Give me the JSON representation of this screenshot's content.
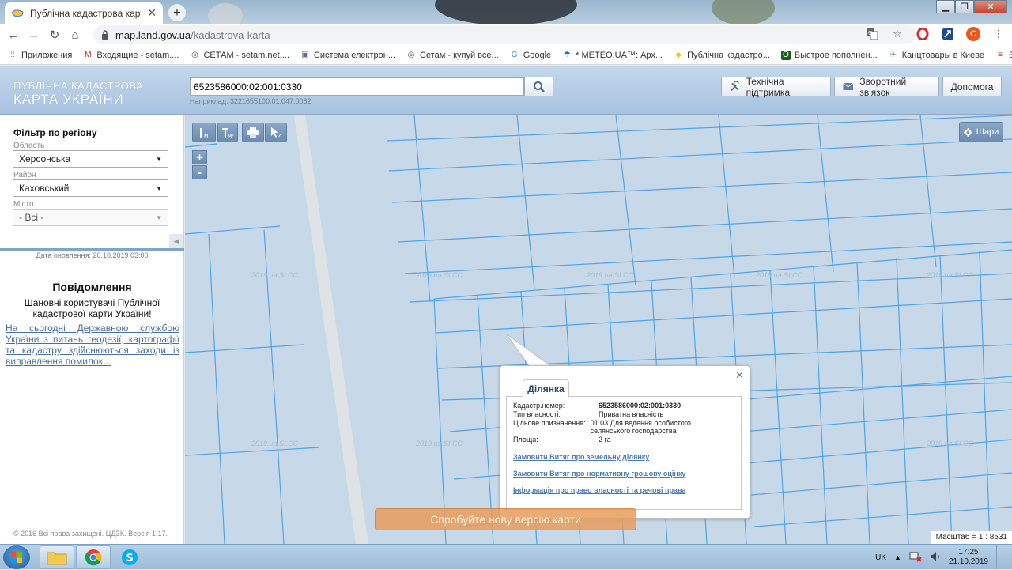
{
  "browser": {
    "tab_title": "Публічна кадастрова карта Укр",
    "url_host": "map.land.gov.ua",
    "url_path": "/kadastrova-karta",
    "profile_initial": "С",
    "bookmarks": [
      {
        "label": "Приложения",
        "icon": "apps-icon"
      },
      {
        "label": "Входящие - setam....",
        "icon": "gmail-icon"
      },
      {
        "label": "СЕТАМ - setam.net....",
        "icon": "globe-icon"
      },
      {
        "label": "Система електрон...",
        "icon": "document-icon"
      },
      {
        "label": "Сетам - купуй все...",
        "icon": "globe-icon"
      },
      {
        "label": "Google",
        "icon": "google-icon"
      },
      {
        "label": "* METEO.UA™: Арх...",
        "icon": "umbrella-icon"
      },
      {
        "label": "Публічна кадастро...",
        "icon": "ukraine-map-icon"
      },
      {
        "label": "Быстрое пополнен...",
        "icon": "o-letter-icon"
      },
      {
        "label": "Канцтовары в Киеве",
        "icon": "cart-icon"
      },
      {
        "label": "ВМ",
        "icon": "bars-icon"
      }
    ]
  },
  "header": {
    "logo_top": "ПУБЛІЧНА КАДАСТРОВА",
    "logo_bottom": "КАРТА УКРАЇНИ",
    "search_value": "6523586000:02:001:0330",
    "search_hint": "Наприклад: 3221655100:01:047:0062",
    "support_label": "Технічна підтримка",
    "feedback_label": "Зворотний зв'язок",
    "help_label": "Допомога"
  },
  "sidebar": {
    "filter_title": "Фільтр по регіону",
    "oblast_label": "Область",
    "oblast_value": "Херсонська",
    "rayon_label": "Район",
    "rayon_value": "Каховський",
    "city_label": "Місто",
    "city_value": "- Всі -",
    "update_date": "Дата оновлення: 20.10.2019 03:00",
    "message_title": "Повідомлення",
    "message_greeting": "Шановні користувачі Публічної кадастрової карти України!",
    "message_link": "На сьогодні Державною службою України з питань геодезії, картографії та кадастру здійснюються заходи із виправлення помилок...",
    "copyright": "© 2016 Всі права захищені. ЦДЗК. Версія 1.17."
  },
  "map": {
    "layers_label": "Шари",
    "watermark": "2019.ua.SI.CC",
    "scale": "Масштаб = 1 : 8531",
    "try_new_version": "Спробуйте нову версію карти",
    "parcel_color": "#4fa3e8",
    "road_color": "#dfe3e6"
  },
  "popup": {
    "tab": "Ділянка",
    "rows": [
      {
        "key": "Кадастр.номер:",
        "value": "6523586000:02:001:0330"
      },
      {
        "key": "Тип власності:",
        "value": "Приватна власність"
      },
      {
        "key": "Цільове призначення:",
        "value": "01.03 Для ведення особистого селянського господарства"
      },
      {
        "key": "Площа:",
        "value": "2 га"
      }
    ],
    "links": [
      "Замовити Витяг про земельну ділянку",
      "Замовити Витяг про нормативну грошову оцінку",
      "Інформація про право власності та речові права"
    ]
  },
  "taskbar": {
    "lang": "UK",
    "time": "17:25",
    "date": "21.10.2019"
  }
}
